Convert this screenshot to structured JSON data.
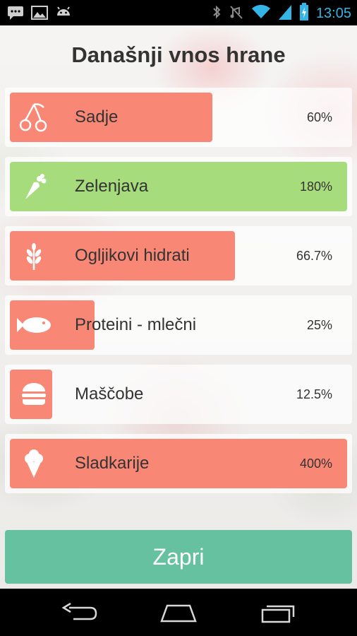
{
  "status_bar": {
    "time": "13:05",
    "left_icons": [
      "message-icon",
      "image-icon",
      "android-icon"
    ],
    "right_icons": [
      "bluetooth-icon",
      "mute-icon",
      "wifi-icon",
      "signal-icon",
      "battery-charging-icon"
    ]
  },
  "screen": {
    "title": "Današnji vnos hrane"
  },
  "colors": {
    "red_fill": "#f98776",
    "green_fill": "#a6dc7c",
    "button": "#66c1a0"
  },
  "food_groups": [
    {
      "label": "Sadje",
      "percent_text": "60%",
      "level": 60,
      "icon": "cherry-icon",
      "color": "#f98776"
    },
    {
      "label": "Zelenjava",
      "percent_text": "180%",
      "level": 180,
      "icon": "carrot-icon",
      "color": "#a6dc7c"
    },
    {
      "label": "Ogljikovi hidrati",
      "percent_text": "66.7%",
      "level": 66.7,
      "icon": "wheat-icon",
      "color": "#f98776"
    },
    {
      "label": "Proteini - mlečni",
      "percent_text": "25%",
      "level": 25,
      "icon": "fish-icon",
      "color": "#f98776"
    },
    {
      "label": "Maščobe",
      "percent_text": "12.5%",
      "level": 12.5,
      "icon": "burger-icon",
      "color": "#f98776"
    },
    {
      "label": "Sladkarije",
      "percent_text": "400%",
      "level": 400,
      "icon": "ice-cream-icon",
      "color": "#f98776"
    }
  ],
  "actions": {
    "close_label": "Zapri"
  },
  "nav_bar": {
    "buttons": [
      "back-icon",
      "home-icon",
      "recent-apps-icon"
    ]
  }
}
